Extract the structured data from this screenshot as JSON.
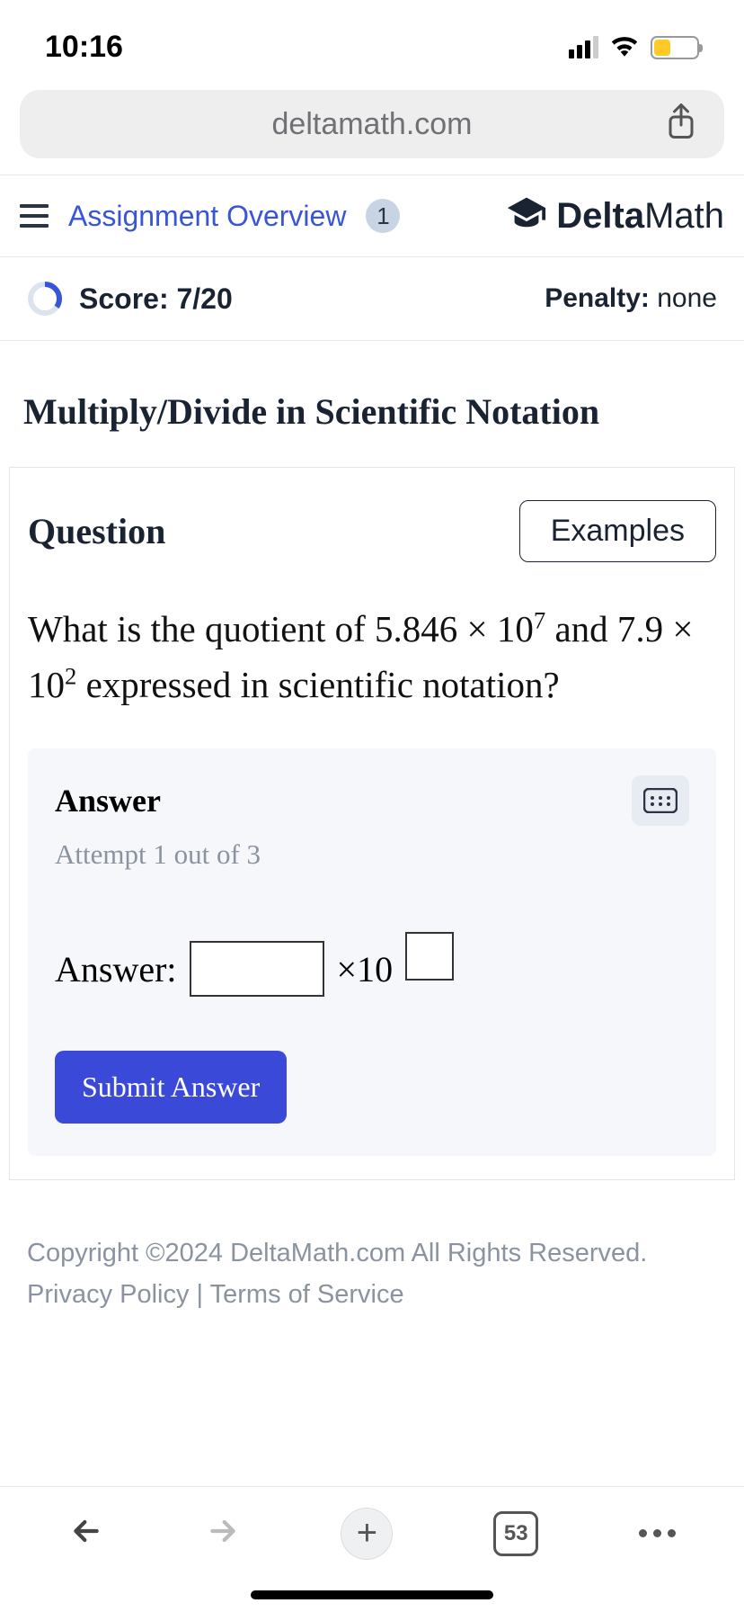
{
  "status": {
    "time": "10:16"
  },
  "browser": {
    "url": "deltamath.com",
    "tab_count": "53"
  },
  "header": {
    "assignment_link": "Assignment Overview",
    "assignment_badge": "1",
    "brand_bold": "Delta",
    "brand_light": "Math"
  },
  "score": {
    "label": "Score: 7/20",
    "penalty_label": "Penalty:",
    "penalty_value": "none"
  },
  "section_title": "Multiply/Divide in Scientific Notation",
  "question": {
    "heading": "Question",
    "examples_btn": "Examples",
    "prompt_pre": "What is the quotient of ",
    "coeff1": "5.846",
    "exp1": "7",
    "mid": " and ",
    "coeff2": "7.9",
    "exp2": "2",
    "prompt_post": " expressed in scientific notation?"
  },
  "answer": {
    "heading": "Answer",
    "attempt": "Attempt 1 out of 3",
    "label": "Answer:",
    "times": "×10",
    "submit": "Submit Answer"
  },
  "footer": {
    "copyright": "Copyright ©2024 DeltaMath.com All Rights Reserved.",
    "privacy": "Privacy Policy",
    "sep": " | ",
    "terms": "Terms of Service"
  }
}
